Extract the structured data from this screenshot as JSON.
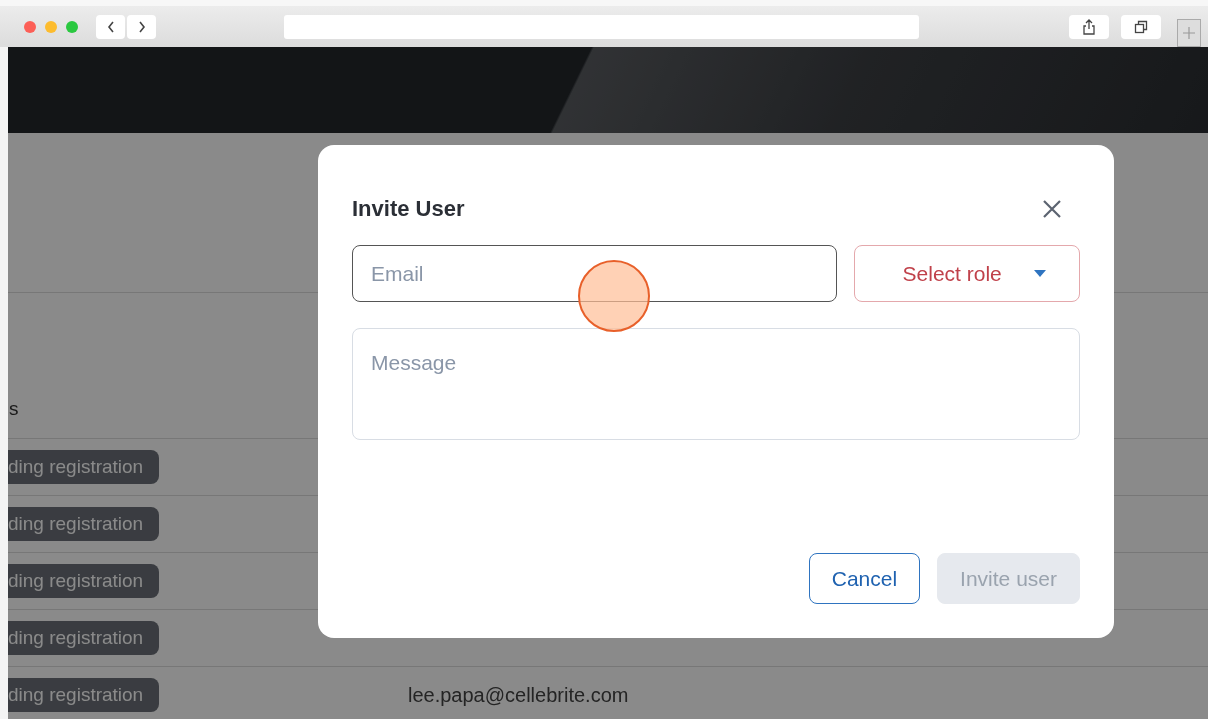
{
  "table": {
    "columns": [
      "s"
    ],
    "rows": [
      {
        "status": "ding registration"
      },
      {
        "status": "ding registration"
      },
      {
        "status": "ding registration"
      },
      {
        "status": "ding registration"
      },
      {
        "status": "ding registration",
        "email": "lee.papa@cellebrite.com"
      }
    ]
  },
  "dialog": {
    "title": "Invite User",
    "email": {
      "placeholder": "Email"
    },
    "role": {
      "label": "Select role"
    },
    "message": {
      "placeholder": "Message"
    },
    "buttons": [
      {
        "label": "Cancel",
        "disabled": false
      },
      {
        "label": "Invite user",
        "disabled": true
      }
    ]
  }
}
